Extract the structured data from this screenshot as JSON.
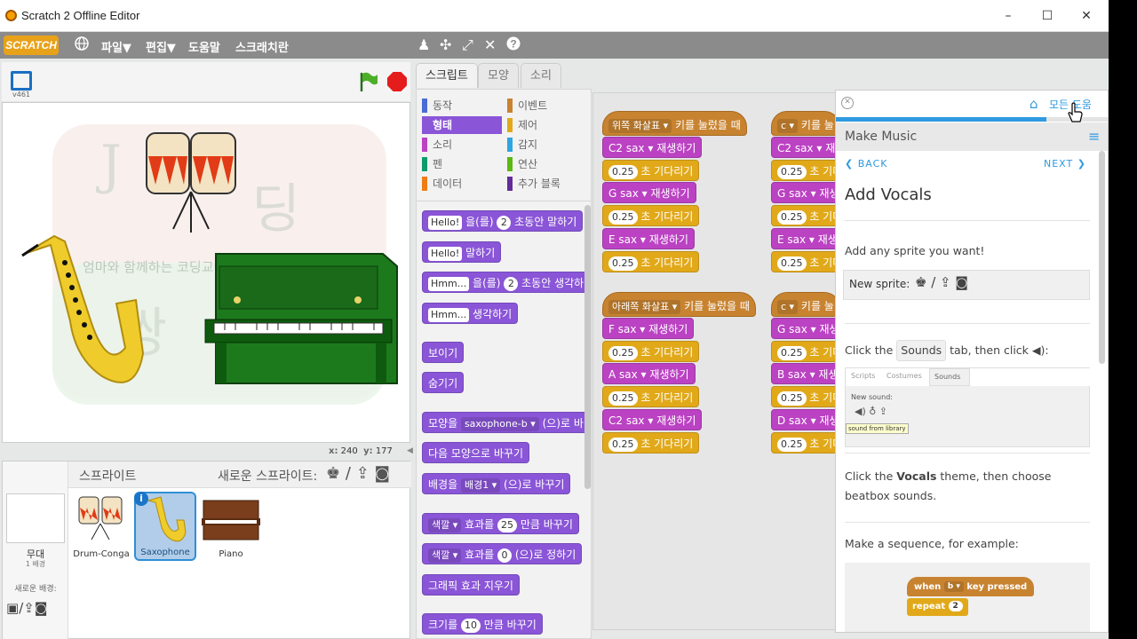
{
  "window": {
    "title": "Scratch 2 Offline Editor",
    "minimize": "–",
    "maximize": "☐",
    "close": "✕"
  },
  "menu": {
    "logo": "SCRATCH",
    "items": [
      "파일▼",
      "편집▼",
      "도움말",
      "스크래치란"
    ]
  },
  "stage": {
    "version": "v461",
    "coords_x_label": "x:",
    "coords_x": "240",
    "coords_y_label": "y:",
    "coords_y": "177"
  },
  "stage_text": {
    "watermark_line": "엄마와 함께하는 코딩교실"
  },
  "tabs": [
    "스크립트",
    "모양",
    "소리"
  ],
  "categories": [
    {
      "label": "동작",
      "color": "#4a6cd4"
    },
    {
      "label": "이벤트",
      "color": "#c88330"
    },
    {
      "label": "형태",
      "color": "#8a55d7",
      "selected": true
    },
    {
      "label": "제어",
      "color": "#e1a91a"
    },
    {
      "label": "소리",
      "color": "#bb42c3"
    },
    {
      "label": "감지",
      "color": "#2ca5e2"
    },
    {
      "label": "펜",
      "color": "#0e9a6c"
    },
    {
      "label": "연산",
      "color": "#5cb712"
    },
    {
      "label": "데이터",
      "color": "#ee7d16"
    },
    {
      "label": "추가 블록",
      "color": "#632d99"
    }
  ],
  "palette_blocks": {
    "b1_slot": "Hello!",
    "b1_mid": "을(를)",
    "b1_num": "2",
    "b1_end": "초동안 말하기",
    "b2_slot": "Hello!",
    "b2_end": "말하기",
    "b3_slot": "Hmm...",
    "b3_mid": "을(를)",
    "b3_num": "2",
    "b3_end": "초동안 생각하",
    "b4_slot": "Hmm...",
    "b4_end": "생각하기",
    "b5": "보이기",
    "b6": "숨기기",
    "b7_start": "모양을",
    "b7_drop": "saxophone-b ▾",
    "b7_end": "(으)로 바",
    "b8": "다음 모양으로 바꾸기",
    "b9_start": "배경을",
    "b9_drop": "배경1 ▾",
    "b9_end": "(으)로 바꾸기",
    "b10_drop": "색깔 ▾",
    "b10_mid": "효과를",
    "b10_num": "25",
    "b10_end": "만큼 바꾸기",
    "b11_drop": "색깔 ▾",
    "b11_mid": "효과를",
    "b11_num": "0",
    "b11_end": "(으)로 정하기",
    "b12": "그래픽 효과 지우기",
    "b13_start": "크기를",
    "b13_num": "10",
    "b13_end": "만큼 바꾸기"
  },
  "scripts": {
    "s1_hat_drop": "위쪽 화살표 ▾",
    "s1_hat_end": "키를 눌렀을 때",
    "s1_notes": [
      {
        "note": "C2 sax ▾",
        "label": "재생하기"
      },
      {
        "note": "G sax ▾",
        "label": "재생하기"
      },
      {
        "note": "E sax ▾",
        "label": "재생하기"
      }
    ],
    "wait_num": "0.25",
    "wait_label": "초 기다리기",
    "s2_hat_drop": "c ▾",
    "s2_hat_end": "키를 눌",
    "s2_notes": [
      "C2 sax ▾",
      "G sax ▾",
      "E sax ▾"
    ],
    "s2_cut": "재생",
    "s2_wait_cut": "초 기다",
    "s3_hat_drop": "아래쪽 화살표 ▾",
    "s3_hat_end": "키를 눌렀을 때",
    "s3_notes": [
      {
        "note": "F sax ▾",
        "label": "재생하기"
      },
      {
        "note": "A sax ▾",
        "label": "재생하기"
      },
      {
        "note": "C2 sax ▾",
        "label": "재생하기"
      }
    ],
    "s4_hat_drop": "c ▾",
    "s4_hat_end": "키를 눌",
    "s4_notes": [
      "G sax ▾",
      "B sax ▾",
      "D sax ▾"
    ]
  },
  "sprite_pane": {
    "title": "스프라이트",
    "new_sprite": "새로운 스프라이트:",
    "stage_label": "무대",
    "stage_count": "1 배경",
    "new_backdrop": "새로운 배경:",
    "sprites": [
      {
        "name": "Drum-Conga"
      },
      {
        "name": "Saxophone",
        "selected": true
      },
      {
        "name": "Piano"
      }
    ]
  },
  "help": {
    "all_help": "모든 도움",
    "section": "Make Music",
    "back": "BACK",
    "next": "NEXT",
    "step_title": "Add Vocals",
    "p1": "Add any sprite you want!",
    "new_sprite": "New sprite:",
    "p2_a": "Click the",
    "p2_tab": "Sounds",
    "p2_b": "tab, then click",
    "mini_tabs": [
      "Scripts",
      "Costumes",
      "Sounds"
    ],
    "mini_new_sound": "New sound:",
    "mini_tip": "sound from library",
    "p3_a": "Click the",
    "p3_bold": "Vocals",
    "p3_b": "theme, then choose beatbox sounds.",
    "p4": "Make a sequence, for example:",
    "ex_when": "when",
    "ex_key": "b ▾",
    "ex_pressed": "key pressed",
    "ex_repeat": "repeat",
    "ex_num": "2",
    "progress": 0.77
  }
}
